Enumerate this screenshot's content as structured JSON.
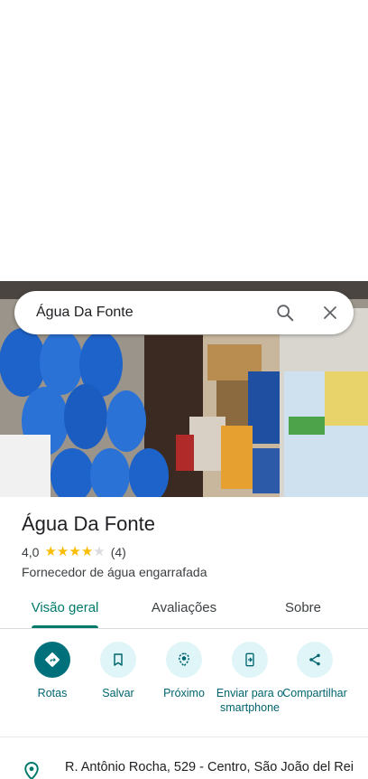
{
  "search": {
    "query": "Água Da Fonte"
  },
  "place": {
    "name": "Água Da Fonte",
    "rating": "4,0",
    "stars": 4,
    "stars_max": 5,
    "review_count": "(4)",
    "category": "Fornecedor de água engarrafada"
  },
  "tabs": [
    {
      "label": "Visão geral",
      "active": true
    },
    {
      "label": "Avaliações",
      "active": false
    },
    {
      "label": "Sobre",
      "active": false
    }
  ],
  "actions": [
    {
      "label": "Rotas",
      "icon": "directions-icon"
    },
    {
      "label": "Salvar",
      "icon": "bookmark-icon"
    },
    {
      "label": "Próximo",
      "icon": "nearby-icon"
    },
    {
      "label": "Enviar para o smartphone",
      "icon": "send-to-phone-icon"
    },
    {
      "label": "Compartilhar",
      "icon": "share-icon"
    }
  ],
  "address": {
    "text": "R. Antônio Rocha, 529 - Centro, São João del Rei"
  },
  "colors": {
    "accent": "#00796b",
    "primary_action": "#00717a",
    "star": "#fbbc04"
  }
}
